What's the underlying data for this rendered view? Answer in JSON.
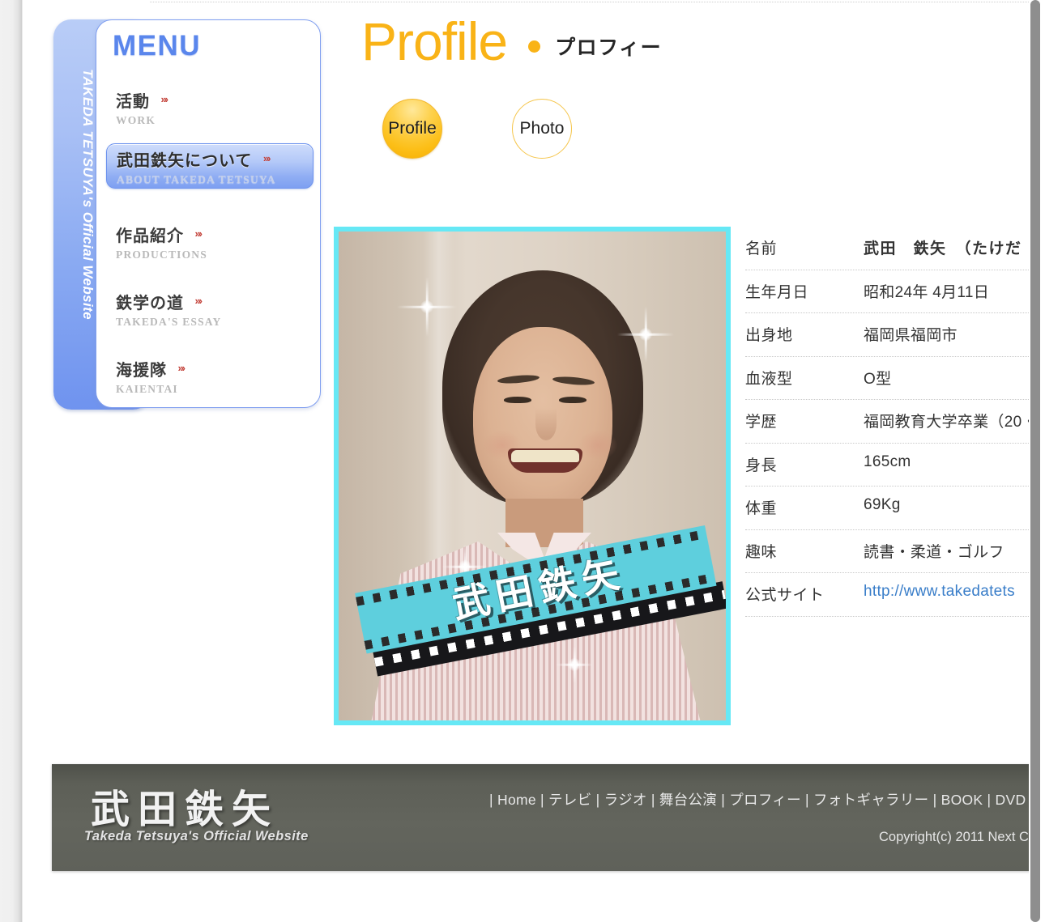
{
  "site": {
    "vertical_tab_label": "TAKEDA TETSUYA's Official Website"
  },
  "menu": {
    "heading": "MENU",
    "arrows": "»›",
    "items": [
      {
        "ja": "活動",
        "en": "WORK",
        "active": false
      },
      {
        "ja": "武田鉄矢について",
        "en": "ABOUT TAKEDA TETSUYA",
        "active": true
      },
      {
        "ja": "作品紹介",
        "en": "PRODUCTIONS",
        "active": false
      },
      {
        "ja": "鉄学の道",
        "en": "TAKEDA'S ESSAY",
        "active": false
      },
      {
        "ja": "海援隊",
        "en": "KAIENTAI",
        "active": false
      }
    ]
  },
  "page": {
    "title_en": "Profile",
    "title_ja": "プロフィー"
  },
  "tabs": [
    {
      "label": "Profile",
      "selected": true
    },
    {
      "label": "Photo",
      "selected": false
    }
  ],
  "photo": {
    "placard_name": "武田鉄矢",
    "frame_color": "#66e8f5"
  },
  "profile": {
    "rows": [
      {
        "label": "名前",
        "value": "武田　鉄矢　（たけだ",
        "bold": true,
        "link": false
      },
      {
        "label": "生年月日",
        "value": "昭和24年 4月11日",
        "bold": false,
        "link": false
      },
      {
        "label": "出身地",
        "value": "福岡県福岡市",
        "bold": false,
        "link": false
      },
      {
        "label": "血液型",
        "value": "O型",
        "bold": false,
        "link": false
      },
      {
        "label": "学歴",
        "value": "福岡教育大学卒業（20・",
        "bold": false,
        "link": false
      },
      {
        "label": "身長",
        "value": "165cm",
        "bold": false,
        "link": false
      },
      {
        "label": "体重",
        "value": "69Kg",
        "bold": false,
        "link": false
      },
      {
        "label": "趣味",
        "value": "読書・柔道・ゴルフ",
        "bold": false,
        "link": false
      },
      {
        "label": "公式サイト",
        "value": "http://www.takedatets",
        "bold": false,
        "link": true
      }
    ]
  },
  "footer": {
    "logo_ja": "武田鉄矢",
    "logo_en": "Takeda Tetsuya's Official Website",
    "nav": "| Home  | テレビ  | ラジオ  | 舞台公演  | プロフィー  | フォトギャラリー  | BOOK  | DVD",
    "copyright": "Copyright(c) 2011 Next C"
  }
}
